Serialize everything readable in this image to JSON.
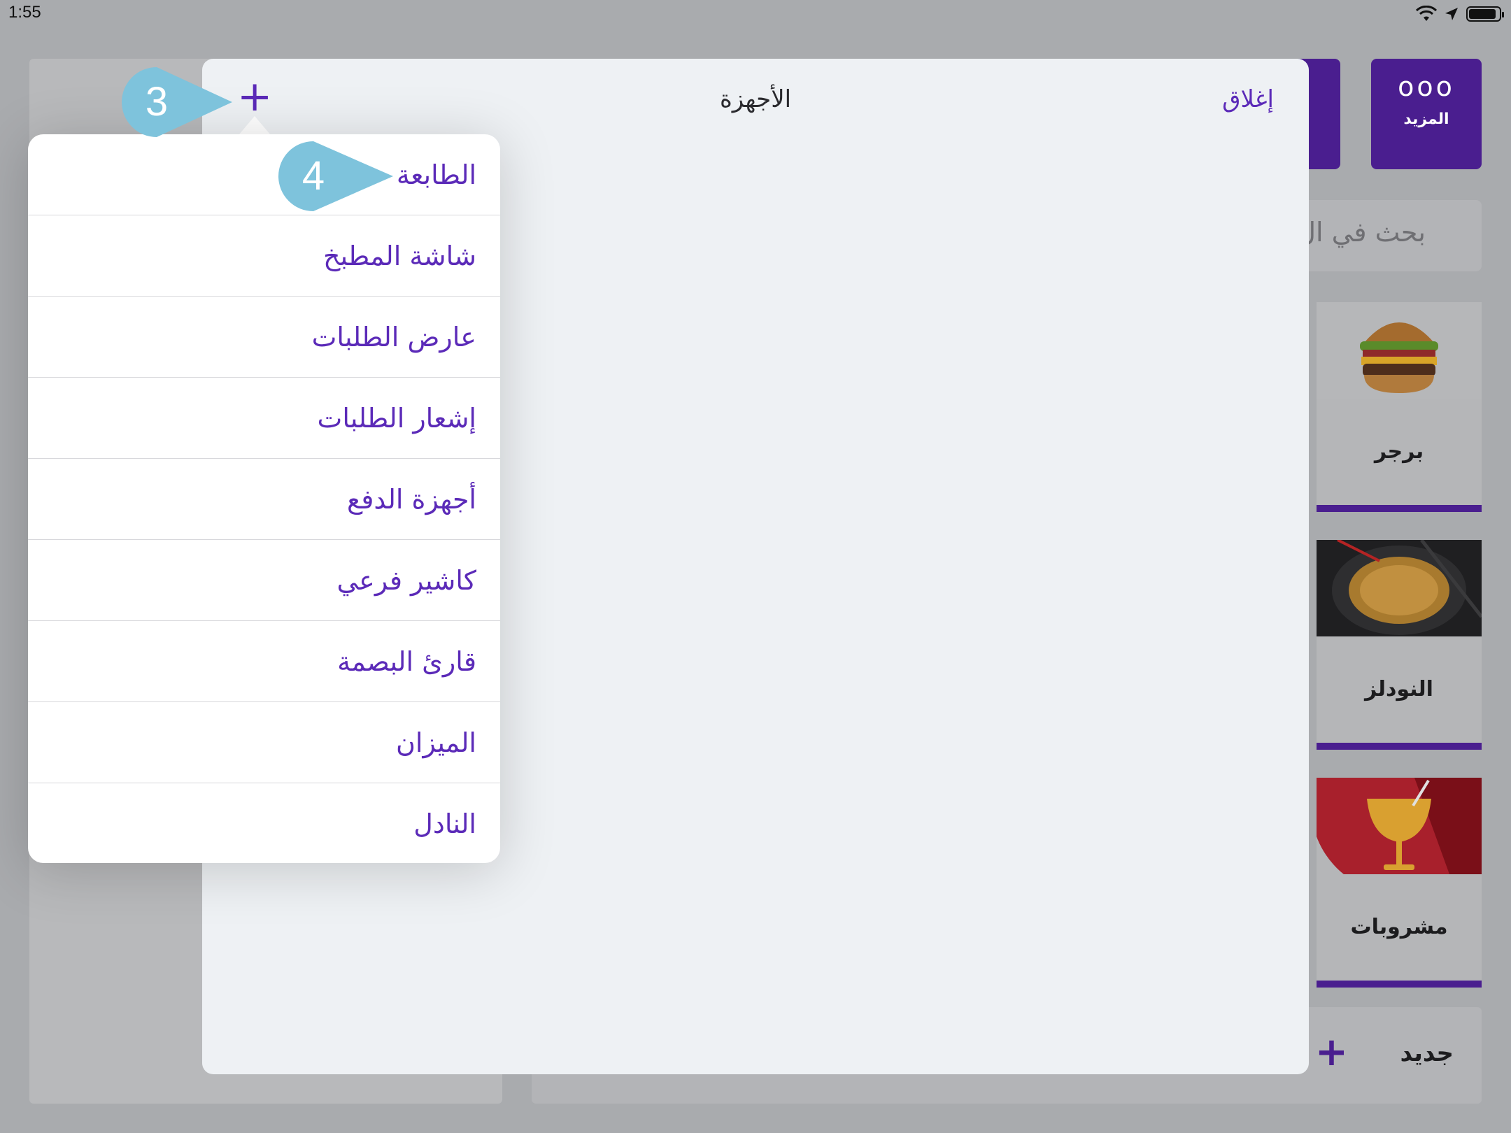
{
  "status_bar": {
    "time": "1:55",
    "battery_level": 0.9
  },
  "background": {
    "more_button": {
      "icon": "ooo",
      "label": "المزيد"
    },
    "search_placeholder": "بحث في ال",
    "categories": [
      {
        "label": "برجر",
        "image": "burger"
      },
      {
        "label": "النودلز",
        "image": "noodles"
      },
      {
        "label": "مشروبات",
        "image": "drink"
      }
    ],
    "new_button": {
      "label": "جديد",
      "icon": "+"
    }
  },
  "modal": {
    "title": "الأجهزة",
    "close_label": "إغلاق",
    "add_icon": "+"
  },
  "menu": {
    "items": [
      "الطابعة",
      "شاشة المطبخ",
      "عارض الطلبات",
      "إشعار الطلبات",
      "أجهزة الدفع",
      "كاشير فرعي",
      "قارئ البصمة",
      "الميزان",
      "النادل"
    ]
  },
  "callouts": [
    {
      "number": "3"
    },
    {
      "number": "4"
    }
  ],
  "colors": {
    "accent": "#5b2ab8",
    "callout": "#7ec3dc"
  }
}
